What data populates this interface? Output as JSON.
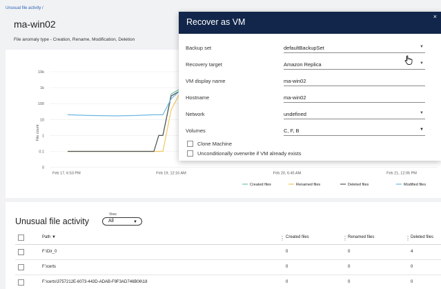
{
  "breadcrumb": "Unusual file activity /",
  "title": "ma-win02",
  "subtitle": "File anomaly type - Creation, Rename, Modification, Deletion",
  "chart_data": {
    "type": "line",
    "ylabel": "File count",
    "yscale": "log",
    "y_ticks": [
      "10k",
      "1k",
      "100",
      "10",
      "1",
      "0.1",
      "0"
    ],
    "x_ticks": [
      "Feb 17, 6:53 PM",
      "Feb 19, 12:16 AM",
      "Feb 20, 6:45 AM",
      "Feb 21, 12:06 PM"
    ],
    "legend_position": "bottom-right",
    "series": [
      {
        "name": "Created files",
        "color": "#6fc3a8",
        "values": [
          0.1,
          0.1,
          0.1,
          0.1,
          0.1,
          1,
          1,
          400,
          800
        ]
      },
      {
        "name": "Renamed files",
        "color": "#f2c75e",
        "values": [
          0.1,
          0.1,
          0.1,
          0.1,
          0.1,
          0.1,
          0.1,
          40,
          400
        ]
      },
      {
        "name": "Deleted files",
        "color": "#555555",
        "values": [
          0.1,
          0.1,
          0.1,
          0.1,
          0.1,
          1,
          1,
          300,
          600
        ]
      },
      {
        "name": "Modified files",
        "color": "#6cb6e0",
        "values": [
          20,
          18,
          17,
          18,
          20,
          20,
          20,
          200,
          600
        ]
      }
    ]
  },
  "activity": {
    "title": "Unusual file activity",
    "view_label": "View",
    "view_value": "All",
    "columns": {
      "path": "Path",
      "created": "Created files",
      "renamed": "Renamed files",
      "deleted": "Deleted files"
    },
    "filter_icon": "filter-funnel",
    "rows": [
      {
        "path": "F:\\Dir_0",
        "created": "0",
        "renamed": "0",
        "deleted": "4"
      },
      {
        "path": "F:\\certs",
        "created": "0",
        "renamed": "0",
        "deleted": "0"
      },
      {
        "path": "F:\\certs\\3757212E-6073-443D-ADAB-F9F3AD746B06\\18",
        "created": "0",
        "renamed": "0",
        "deleted": "0"
      }
    ]
  },
  "dialog": {
    "title": "Recover as VM",
    "close": "×",
    "backup_set_label": "Backup set",
    "backup_set_value": "defaultBackupSet",
    "recovery_target_label": "Recovery target",
    "recovery_target_value": "Amazon Replica",
    "vm_name_label": "VM display name",
    "vm_name_value": "ma-win02",
    "hostname_label": "Hostname",
    "hostname_value": "ma-win02",
    "network_label": "Network",
    "network_value": "undefined",
    "volumes_label": "Volumes",
    "volumes_value": "C,  F,  B",
    "clone_label": "Clone Machine",
    "overwrite_label": "Unconditionally overwrite if VM already exists",
    "caret_icon": "chevron-down-icon",
    "cursor_icon": "hand-pointer-icon"
  }
}
